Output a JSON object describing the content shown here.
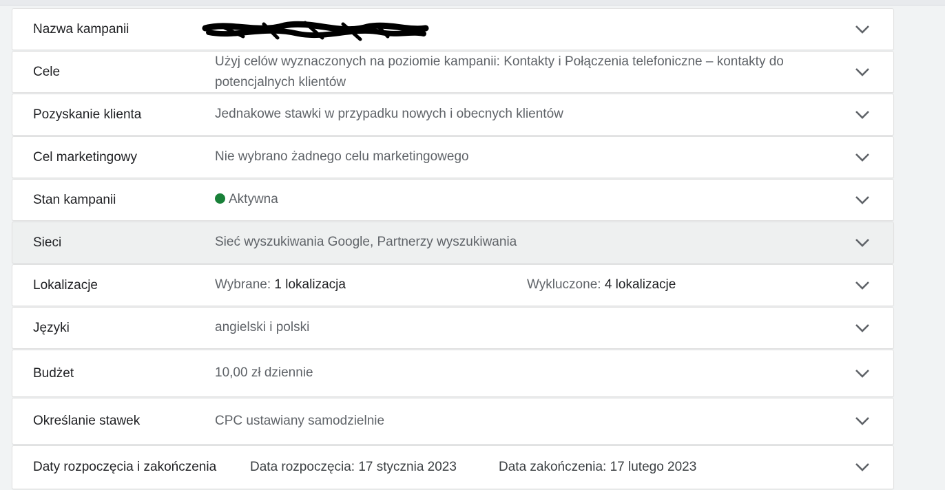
{
  "settings": {
    "rows": [
      {
        "label": "Nazwa kampanii",
        "value": ""
      },
      {
        "label": "Cele",
        "value": "Użyj celów wyznaczonych na poziomie kampanii: Kontakty i Połączenia telefoniczne – kontakty do potencjalnych klientów"
      },
      {
        "label": "Pozyskanie klienta",
        "value": "Jednakowe stawki w przypadku nowych i obecnych klientów"
      },
      {
        "label": "Cel marketingowy",
        "value": "Nie wybrano żadnego celu marketingowego"
      },
      {
        "label": "Stan kampanii",
        "value": "Aktywna",
        "status_color": "#188038"
      },
      {
        "label": "Sieci",
        "value": "Sieć wyszukiwania Google, Partnerzy wyszukiwania"
      },
      {
        "label": "Lokalizacje",
        "selected_label": "Wybrane:",
        "selected_value": "1 lokalizacja",
        "excluded_label": "Wykluczone:",
        "excluded_value": "4 lokalizacje"
      },
      {
        "label": "Języki",
        "value": "angielski i polski"
      },
      {
        "label": "Budżet",
        "value": "10,00 zł dziennie"
      },
      {
        "label": "Określanie stawek",
        "value": "CPC ustawiany samodzielnie"
      },
      {
        "label": "Daty rozpoczęcia i zakończenia",
        "start": "Data rozpoczęcia: 17 stycznia 2023",
        "end": "Data zakończenia: 17 lutego 2023"
      }
    ],
    "expand_icon": "chevron-down-icon"
  }
}
